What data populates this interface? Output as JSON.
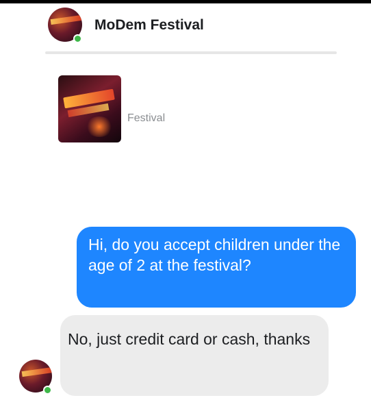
{
  "header": {
    "name": "MoDem Festival",
    "online": true
  },
  "card": {
    "subtitle": "Festival"
  },
  "messages": [
    {
      "direction": "outgoing",
      "text": "Hi, do you accept children under the age of 2 at the festival?"
    },
    {
      "direction": "incoming",
      "text": "No, just credit card or cash, thanks"
    }
  ],
  "colors": {
    "outgoing_bubble": "#1e86ff",
    "incoming_bubble": "#ececec",
    "online_dot": "#3fb84a"
  }
}
